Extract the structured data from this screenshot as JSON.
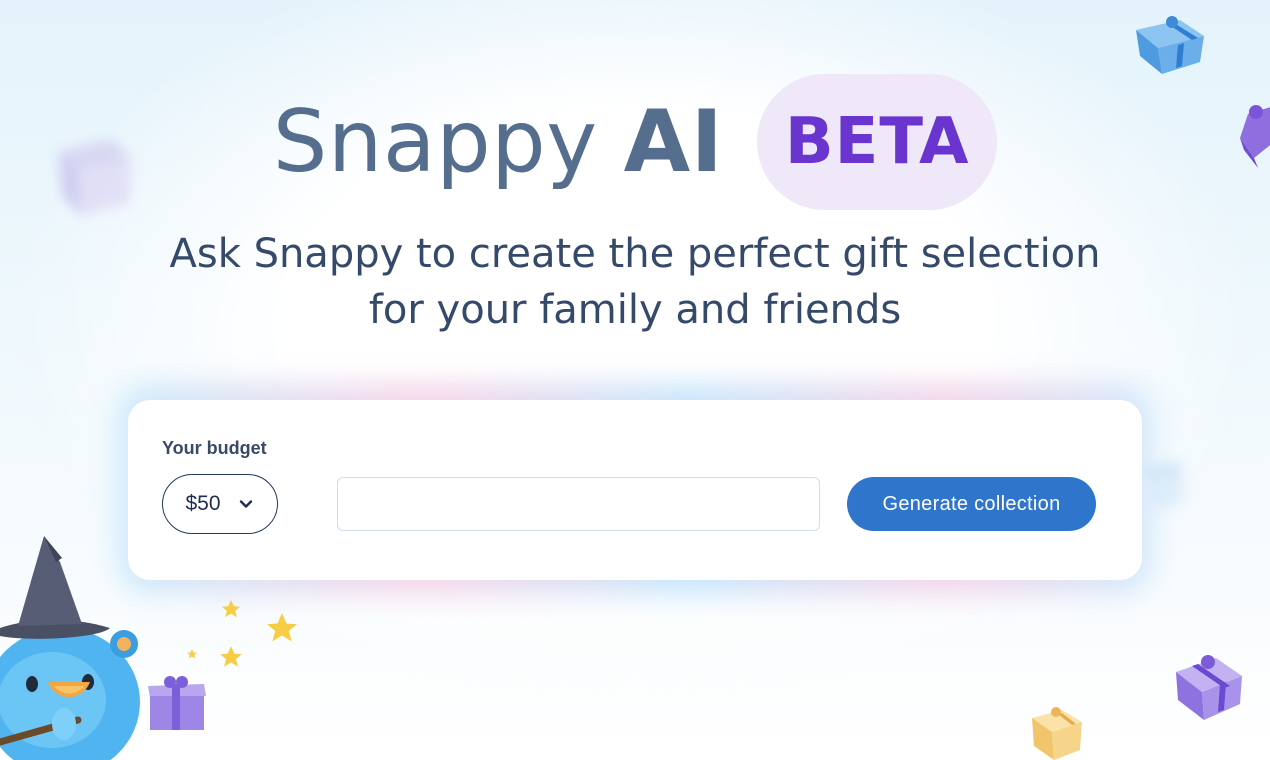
{
  "hero": {
    "title_prefix": "Snappy",
    "title_ai": "AI",
    "badge": "BETA",
    "subtitle_line1": "Ask Snappy to create the perfect gift selection",
    "subtitle_line2": "for your family and friends"
  },
  "form": {
    "budget_label": "Your budget",
    "budget_value": "$50",
    "prompt_value": "",
    "prompt_placeholder": "",
    "generate_label": "Generate collection"
  },
  "colors": {
    "title": "#566e8e",
    "beta_text": "#6a35cf",
    "beta_bg": "#eee8f8",
    "button": "#2f75cc",
    "subtitle": "#35496a"
  },
  "icons": {
    "budget_dropdown": "chevron-down-icon",
    "decor": [
      "gift-box-icon",
      "star-icon",
      "wizard-mascot"
    ]
  }
}
